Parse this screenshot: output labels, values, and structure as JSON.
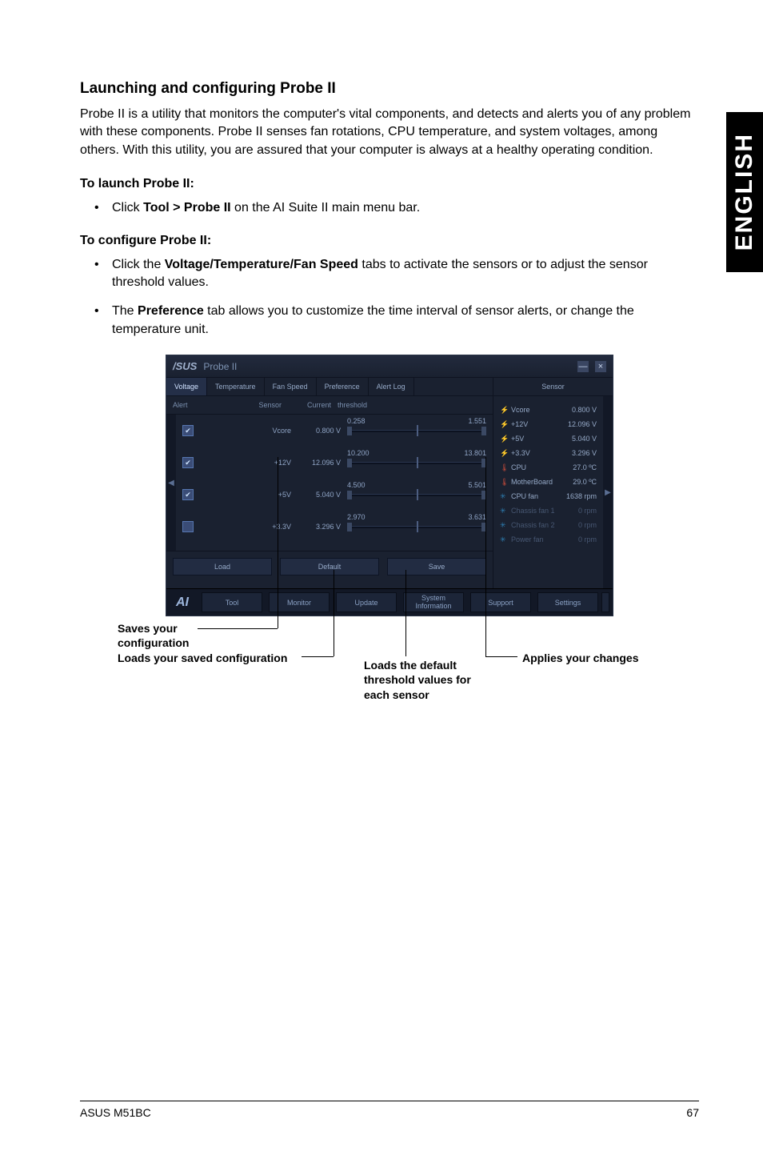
{
  "side_tab": "ENGLISH",
  "heading": "Launching and configuring Probe II",
  "intro_paragraph": "Probe II is a utility that monitors the computer's vital components, and detects and alerts you of any problem with these components. Probe II senses fan rotations, CPU temperature, and system voltages, among others. With this utility, you are assured that your computer is always at a healthy operating condition.",
  "launch_heading": "To launch Probe II:",
  "launch_li_pre": "Click ",
  "launch_li_bold": "Tool > Probe II",
  "launch_li_post": " on the AI Suite II main menu bar.",
  "configure_heading": "To configure Probe II:",
  "cfg_li1_pre": "Click the ",
  "cfg_li1_bold": "Voltage/Temperature/Fan Speed",
  "cfg_li1_post": " tabs to activate the sensors or to adjust the sensor threshold values.",
  "cfg_li2_pre": "The ",
  "cfg_li2_bold": "Preference",
  "cfg_li2_post": " tab allows you to customize the time interval of sensor alerts, or change the temperature unit.",
  "window": {
    "brand": "/SUS",
    "title": "Probe II",
    "tabs": {
      "voltage": "Voltage",
      "temperature": "Temperature",
      "fanspeed": "Fan Speed",
      "preference": "Preference",
      "alertlog": "Alert Log"
    },
    "right_tab": "Sensor",
    "table_headers": {
      "alert": "Alert",
      "sensor": "Sensor",
      "current": "Current",
      "threshold": "threshold"
    },
    "rows": [
      {
        "checked": true,
        "name": "Vcore",
        "current": "0.800 V",
        "thresh_low": "0.258",
        "thresh_high": "1.551"
      },
      {
        "checked": true,
        "name": "+12V",
        "current": "12.096 V",
        "thresh_low": "10.200",
        "thresh_high": "13.801"
      },
      {
        "checked": true,
        "name": "+5V",
        "current": "5.040 V",
        "thresh_low": "4.500",
        "thresh_high": "5.501"
      },
      {
        "checked": false,
        "name": "+3.3V",
        "current": "3.296 V",
        "thresh_low": "2.970",
        "thresh_high": "3.631"
      }
    ],
    "summary": [
      {
        "icon": "bolt",
        "name": "Vcore",
        "value": "0.800 V",
        "dim": false
      },
      {
        "icon": "bolt",
        "name": "+12V",
        "value": "12.096 V",
        "dim": false
      },
      {
        "icon": "bolt",
        "name": "+5V",
        "value": "5.040 V",
        "dim": false
      },
      {
        "icon": "bolt",
        "name": "+3.3V",
        "value": "3.296 V",
        "dim": false
      },
      {
        "icon": "thermo",
        "name": "CPU",
        "value": "27.0 ºC",
        "dim": false
      },
      {
        "icon": "thermo",
        "name": "MotherBoard",
        "value": "29.0 ºC",
        "dim": false
      },
      {
        "icon": "fan",
        "name": "CPU fan",
        "value": "1638 rpm",
        "dim": false
      },
      {
        "icon": "fan",
        "name": "Chassis fan 1",
        "value": "0 rpm",
        "dim": true
      },
      {
        "icon": "fan",
        "name": "Chassis fan 2",
        "value": "0 rpm",
        "dim": true
      },
      {
        "icon": "fan",
        "name": "Power fan",
        "value": "0 rpm",
        "dim": true
      }
    ],
    "buttons": {
      "load": "Load",
      "default": "Default",
      "save": "Save"
    },
    "footer": {
      "tool": "Tool",
      "monitor": "Monitor",
      "update": "Update",
      "system1": "System",
      "system2": "Information",
      "support": "Support",
      "settings": "Settings"
    }
  },
  "callouts": {
    "saves": "Saves your configuration",
    "loads_saved": "Loads your saved configuration",
    "loads_default": "Loads the default threshold values for each sensor",
    "applies": "Applies your changes"
  },
  "footer_left": "ASUS M51BC",
  "footer_right": "67"
}
